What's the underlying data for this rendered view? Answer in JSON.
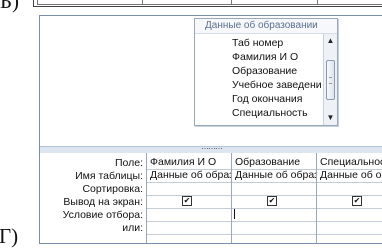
{
  "letters": {
    "b": "Б)",
    "g": "Г)"
  },
  "table_box": {
    "title": "Данные об образовании",
    "fields": [
      "Таб номер",
      "Фамилия И О",
      "Образование",
      "Учебное заведение",
      "Год окончания",
      "Специальность"
    ]
  },
  "grid": {
    "row_labels": [
      "Поле:",
      "Имя таблицы:",
      "Сортировка:",
      "Вывод на экран:",
      "Условие отбора:",
      "или:"
    ],
    "columns": [
      {
        "field": "Фамилия И О",
        "table": "Данные об образовании",
        "show": true
      },
      {
        "field": "Образование",
        "table": "Данные об образовании",
        "show": true
      },
      {
        "field": "Специальность",
        "table": "Данные об образовании",
        "show": true
      }
    ]
  },
  "splitter": {
    "grip": "⋯⋯⋯"
  },
  "icons": {
    "scroll_up": "▲",
    "scroll_down": "▼",
    "checkmark": "✔"
  }
}
